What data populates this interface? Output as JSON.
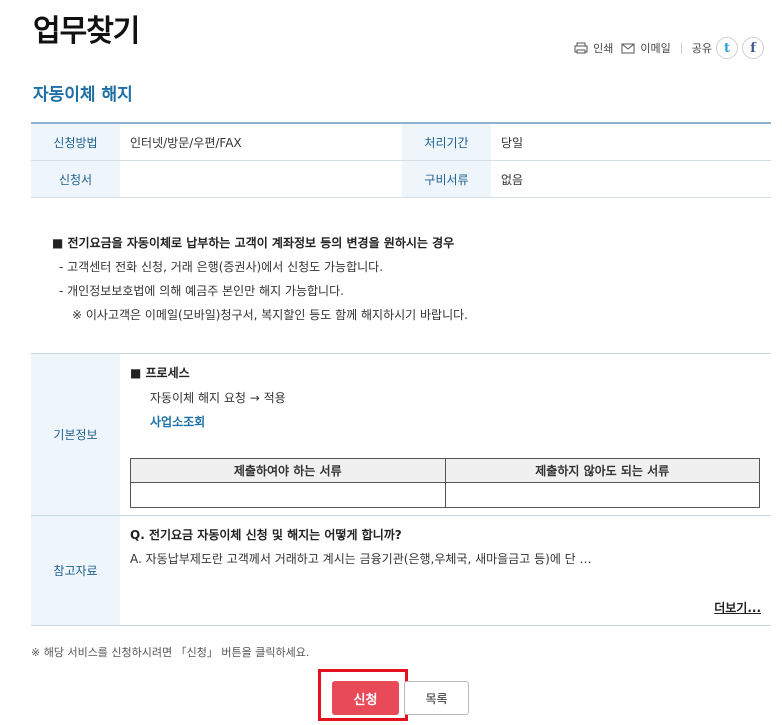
{
  "page": {
    "title": "업무찾기",
    "subtitle": "자동이체 해지"
  },
  "utility": {
    "print": "인쇄",
    "email": "이메일",
    "share": "공유",
    "twitter_glyph": "t",
    "facebook_glyph": "f"
  },
  "info": {
    "method_label": "신청방법",
    "method_value": "인터넷/방문/우편/FAX",
    "period_label": "처리기간",
    "period_value": "당일",
    "form_label": "신청서",
    "form_value": "",
    "docs_label": "구비서류",
    "docs_value": "없음"
  },
  "notice": {
    "head": "■ 전기요금을 자동이체로 납부하는 고객이 계좌정보 등의 변경을 원하시는 경우",
    "line1": "- 고객센터 전화 신청, 거래 은행(증권사)에서 신청도 가능합니다.",
    "line2": "- 개인정보보호법에 의해 예금주 본인만 해지 가능합니다.",
    "line3": "※ 이사고객은 이메일(모바일)청구서, 복지할인 등도 함께 해지하시기 바랍니다."
  },
  "basic": {
    "label": "기본정보",
    "process_head": "■ 프로세스",
    "process_step": "자동이체 해지 요청 → 적용",
    "process_link": "사업소조회",
    "doc_col1": "제출하여야 하는 서류",
    "doc_col2": "제출하지 않아도 되는 서류"
  },
  "reference": {
    "label": "참고자료",
    "question": "Q. 전기요금 자동이체 신청 및 해지는 어떻게 합니까?",
    "answer": "A. 자동납부제도란 고객께서 거래하고 계시는 금융기관(은행,우체국, 새마을금고 등)에 단 …",
    "more": "더보기..."
  },
  "footer": {
    "note": "※ 해당 서비스를 신청하시려면 「신청」 버튼을 클릭하세요.",
    "apply_label": "신청",
    "list_label": "목록"
  },
  "colors": {
    "accent": "#1d6fa5",
    "apply_button": "#e84b57",
    "highlight_box": "#e3101e"
  }
}
